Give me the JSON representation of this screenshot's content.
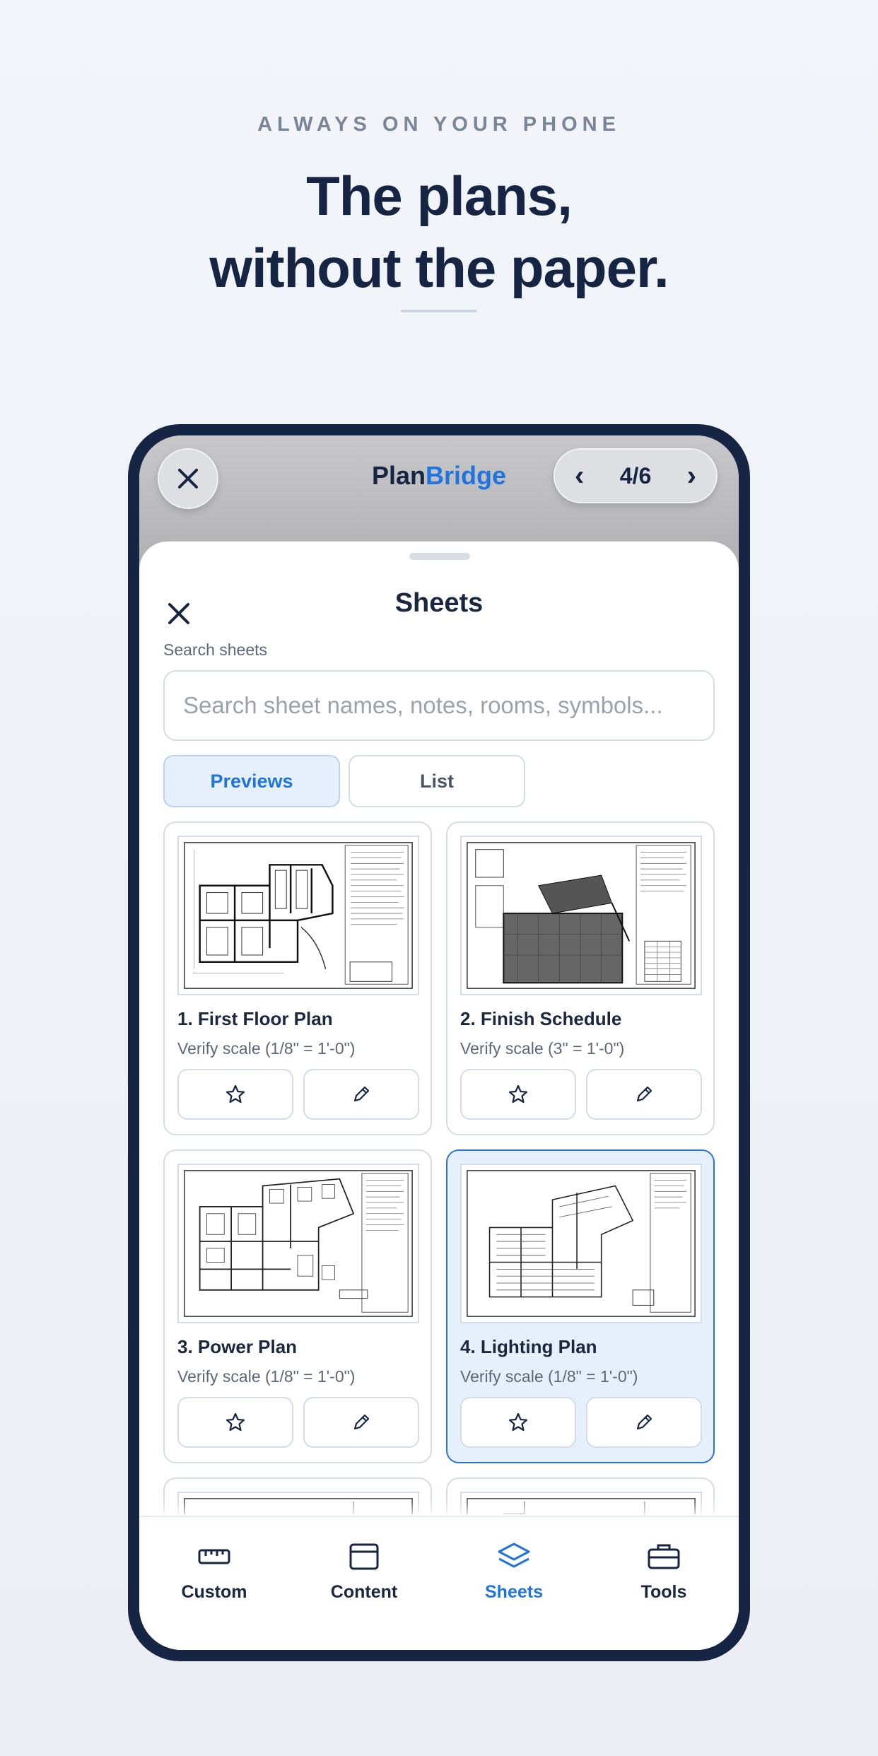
{
  "hero": {
    "kicker": "ALWAYS ON YOUR PHONE",
    "headline_line1": "The plans,",
    "headline_line2": "without the paper."
  },
  "topbar": {
    "brand_part1": "Plan",
    "brand_part2": "Bridge",
    "page_indicator": "4/6",
    "prev_glyph": "‹",
    "next_glyph": "›"
  },
  "sheet_panel": {
    "title": "Sheets",
    "search_label": "Search sheets",
    "search_placeholder": "Search sheet names, notes, rooms, symbols...",
    "search_value": "",
    "view_modes": [
      {
        "label": "Previews",
        "selected": true
      },
      {
        "label": "List",
        "selected": false
      }
    ]
  },
  "sheets": [
    {
      "title": "1. First Floor Plan",
      "scale": "Verify scale (1/8\" = 1'-0\")",
      "selected": false
    },
    {
      "title": "2. Finish Schedule",
      "scale": "Verify scale (3\" = 1'-0\")",
      "selected": false
    },
    {
      "title": "3. Power Plan",
      "scale": "Verify scale (1/8\" = 1'-0\")",
      "selected": false
    },
    {
      "title": "4. Lighting Plan",
      "scale": "Verify scale (1/8\" = 1'-0\")",
      "selected": true
    }
  ],
  "tabbar": {
    "items": [
      {
        "label": "Custom",
        "icon": "ruler-icon",
        "active": false
      },
      {
        "label": "Content",
        "icon": "window-icon",
        "active": false
      },
      {
        "label": "Sheets",
        "icon": "layers-icon",
        "active": true
      },
      {
        "label": "Tools",
        "icon": "toolbox-icon",
        "active": false
      }
    ]
  },
  "colors": {
    "navy": "#152543",
    "accent": "#1f74de",
    "selected_bg": "#e6f0fc",
    "border": "#d5dce6"
  }
}
